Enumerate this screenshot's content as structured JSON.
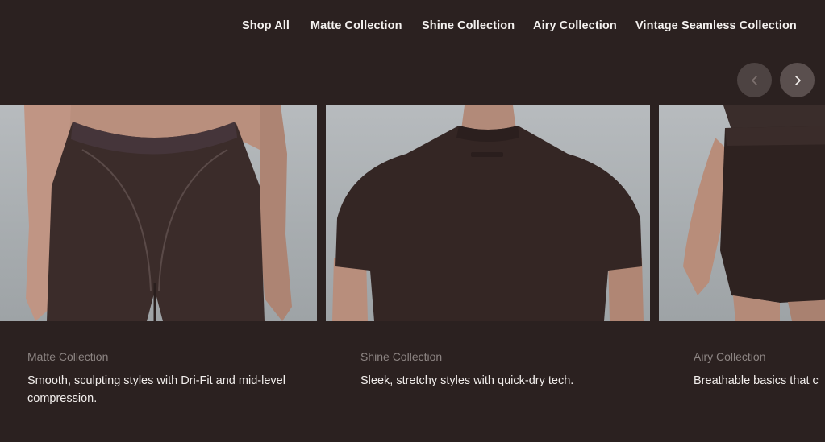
{
  "nav": {
    "items": [
      {
        "label": "Shop All"
      },
      {
        "label": "Matte Collection"
      },
      {
        "label": "Shine Collection"
      },
      {
        "label": "Airy Collection"
      },
      {
        "label": "Vintage Seamless Collection"
      }
    ]
  },
  "carousel": {
    "prev_icon": "chevron-left-icon",
    "next_icon": "chevron-right-icon",
    "cards": [
      {
        "title": "Matte Collection",
        "description": "Smooth, sculpting styles with Dri-Fit and mid-level compression."
      },
      {
        "title": "Shine Collection",
        "description": "Sleek, stretchy styles with quick-dry tech."
      },
      {
        "title": "Airy Collection",
        "description": "Breathable basics that c"
      }
    ]
  },
  "colors": {
    "background": "#2b2120",
    "text": "#f2eeec",
    "muted_text": "#8c8482",
    "garment": "#3b2c2a"
  }
}
